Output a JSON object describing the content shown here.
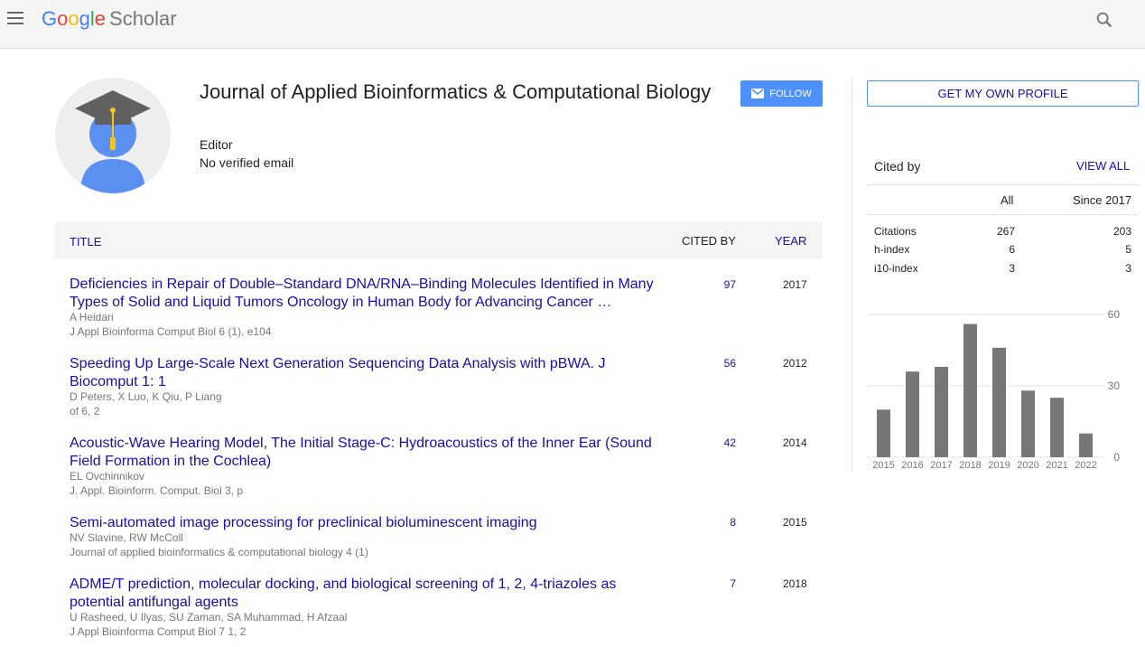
{
  "header": {
    "logo_letters": [
      "G",
      "o",
      "o",
      "g",
      "l",
      "e"
    ],
    "logo_product": "Scholar"
  },
  "profile": {
    "name": "Journal of Applied Bioinformatics & Computational Biology",
    "role": "Editor",
    "email": "No verified email",
    "follow_label": "FOLLOW"
  },
  "table": {
    "col_title": "TITLE",
    "col_cited": "CITED BY",
    "col_year": "YEAR",
    "rows": [
      {
        "title": "Deficiencies in Repair of Double–Standard DNA/RNA–Binding Molecules Identified in Many Types of Solid and Liquid Tumors Oncology in Human Body for Advancing Cancer …",
        "authors": "A Heidari",
        "venue": "J Appl Bioinforma Comput Biol 6 (1), e104",
        "cited": "97",
        "year": "2017"
      },
      {
        "title": "Speeding Up Large-Scale Next Generation Sequencing Data Analysis with pBWA. J Biocomput 1: 1",
        "authors": "D Peters, X Luo, K Qiu, P Liang",
        "venue": "of 6, 2",
        "cited": "56",
        "year": "2012"
      },
      {
        "title": "Acoustic-Wave Hearing Model, The Initial Stage-C: Hydroacoustics of the Inner Ear (Sound Field Formation in the Cochlea)",
        "authors": "EL Ovchinnikov",
        "venue": "J. Appl. Bioinform. Comput. Biol 3, p",
        "cited": "42",
        "year": "2014"
      },
      {
        "title": "Semi-automated image processing for preclinical bioluminescent imaging",
        "authors": "NV Slavine, RW McColl",
        "venue": "Journal of applied bioinformatics & computational biology 4 (1)",
        "cited": "8",
        "year": "2015"
      },
      {
        "title": "ADME/T prediction, molecular docking, and biological screening of 1, 2, 4-triazoles as potential antifungal agents",
        "authors": "U Rasheed, U Ilyas, SU Zaman, SA Muhammad, H Afzaal",
        "venue": "J Appl Bioinforma Comput Biol 7 1, 2",
        "cited": "7",
        "year": "2018"
      }
    ]
  },
  "sidebar": {
    "own_profile_label": "GET MY OWN PROFILE",
    "cited_by_label": "Cited by",
    "view_all_label": "VIEW ALL",
    "col_all": "All",
    "col_since": "Since 2017",
    "stats": [
      {
        "label": "Citations",
        "all": "267",
        "since": "203"
      },
      {
        "label": "h-index",
        "all": "6",
        "since": "5"
      },
      {
        "label": "i10-index",
        "all": "3",
        "since": "3"
      }
    ]
  },
  "colors": {
    "link": "#1a0dab",
    "follow_bg": "#4d90fe",
    "bar": "#777777"
  },
  "chart_data": {
    "type": "bar",
    "categories": [
      "2015",
      "2016",
      "2017",
      "2018",
      "2019",
      "2020",
      "2021",
      "2022"
    ],
    "values": [
      20,
      36,
      38,
      56,
      46,
      28,
      25,
      10
    ],
    "ylim": [
      0,
      60
    ],
    "yticks": [
      "0",
      "30",
      "60"
    ],
    "grid": true
  }
}
